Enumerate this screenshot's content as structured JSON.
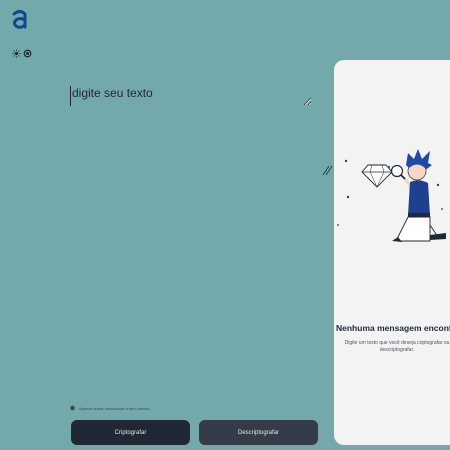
{
  "colors": {
    "background": "#74a9ab",
    "logo": "#0b4b8f",
    "button_primary": "#1f2833",
    "button_secondary": "#343d47",
    "card": "#f3f3f3"
  },
  "header": {
    "logo_letter": "a",
    "logo_icon": "alura-logo-icon"
  },
  "theme_toggle": {
    "sun_icon": "sun-icon",
    "moon_icon": "moon-icon"
  },
  "editor": {
    "placeholder": "digite seu texto",
    "value": ""
  },
  "hint": {
    "icon": "info-icon",
    "text": "Apenas letras minúsculas e sem acento."
  },
  "buttons": {
    "encrypt_label": "Criptografar",
    "decrypt_label": "Descriptografar"
  },
  "output": {
    "illustration": "person-with-magnifier-and-diamond-illustration",
    "title": "Nenhuma mensagem encontrada",
    "description": "Digite um texto que você deseja criptografar ou descriptografar."
  }
}
